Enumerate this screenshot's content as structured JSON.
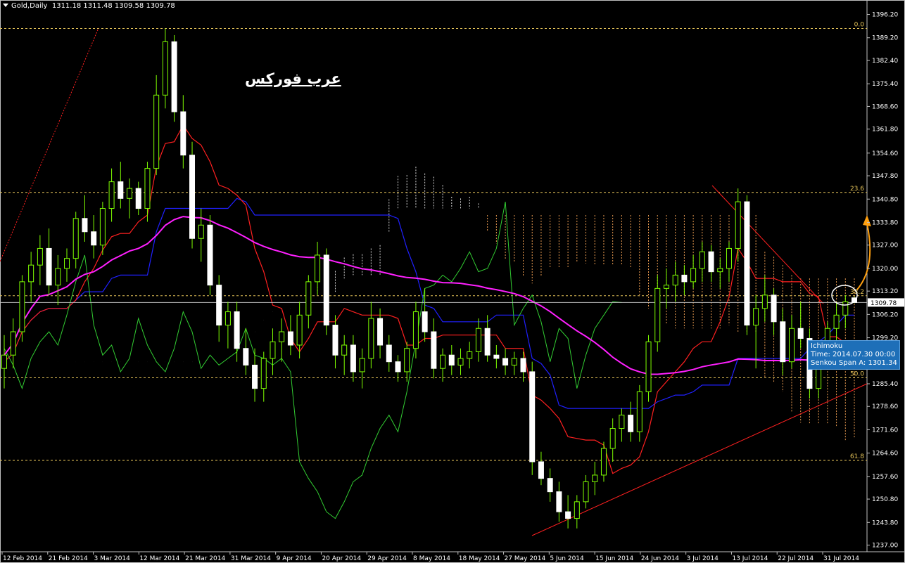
{
  "header": {
    "symbol": "Gold,Daily",
    "ohlc": "1311.18 1311.48 1309.58 1309.78"
  },
  "watermark": "عرب فوركس",
  "current_price_label": "1309.78",
  "tooltip": {
    "name": "Ichimoku",
    "time": "Time: 2014.07.30 00:00",
    "value": "Senkou Span A: 1301.34"
  },
  "colors": {
    "background": "#000000",
    "bull_candle": "#ffffff",
    "bear_candle": "#7fff00",
    "tenkan": "#ff2020",
    "kijun": "#2020ff",
    "chikou": "#32cd32",
    "ma": "#ff20ff",
    "fib": "#e8c65a",
    "trendline": "#ff2020",
    "arrow": "#ffa010",
    "tooltip_bg": "#1e6fb8"
  },
  "chart_data": {
    "type": "candlestick",
    "title": "Gold,Daily",
    "ylim": [
      1235.0,
      1398.0
    ],
    "y_ticks": [
      "1396.20",
      "1389.20",
      "1382.40",
      "1375.40",
      "1368.60",
      "1361.80",
      "1354.60",
      "1347.80",
      "1340.80",
      "1333.80",
      "1327.00",
      "1320.00",
      "1313.20",
      "1306.20",
      "1299.20",
      "1292.20",
      "1285.40",
      "1278.60",
      "1271.60",
      "1264.60",
      "1257.60",
      "1250.80",
      "1243.80",
      "1237.00"
    ],
    "x_ticks": [
      "12 Feb 2014",
      "21 Feb 2014",
      "3 Mar 2014",
      "12 Mar 2014",
      "21 Mar 2014",
      "31 Mar 2014",
      "9 Apr 2014",
      "20 Apr 2014",
      "29 Apr 2014",
      "8 May 2014",
      "18 May 2014",
      "27 May 2014",
      "5 Jun 2014",
      "15 Jun 2014",
      "24 Jun 2014",
      "3 Jul 2014",
      "13 Jul 2014",
      "22 Jul 2014",
      "31 Jul 2014"
    ],
    "fib_levels": [
      {
        "label": "0.0",
        "price": 1392.0
      },
      {
        "label": "23.6",
        "price": 1342.8
      },
      {
        "label": "38.2",
        "price": 1311.8
      },
      {
        "label": "50.0",
        "price": 1287.2
      },
      {
        "label": "61.8",
        "price": 1262.4
      }
    ],
    "last_price": 1309.78,
    "candles": [
      {
        "o": 1290,
        "h": 1300,
        "l": 1284,
        "c": 1294
      },
      {
        "o": 1294,
        "h": 1305,
        "l": 1290,
        "c": 1301
      },
      {
        "o": 1301,
        "h": 1318,
        "l": 1298,
        "c": 1316
      },
      {
        "o": 1316,
        "h": 1325,
        "l": 1310,
        "c": 1321
      },
      {
        "o": 1321,
        "h": 1330,
        "l": 1315,
        "c": 1326
      },
      {
        "o": 1326,
        "h": 1332,
        "l": 1312,
        "c": 1315
      },
      {
        "o": 1315,
        "h": 1324,
        "l": 1309,
        "c": 1320
      },
      {
        "o": 1320,
        "h": 1326,
        "l": 1316,
        "c": 1323
      },
      {
        "o": 1323,
        "h": 1337,
        "l": 1320,
        "c": 1335
      },
      {
        "o": 1335,
        "h": 1342,
        "l": 1328,
        "c": 1331
      },
      {
        "o": 1331,
        "h": 1336,
        "l": 1323,
        "c": 1327
      },
      {
        "o": 1327,
        "h": 1340,
        "l": 1324,
        "c": 1338
      },
      {
        "o": 1338,
        "h": 1350,
        "l": 1334,
        "c": 1346
      },
      {
        "o": 1346,
        "h": 1352,
        "l": 1338,
        "c": 1341
      },
      {
        "o": 1341,
        "h": 1347,
        "l": 1335,
        "c": 1344
      },
      {
        "o": 1344,
        "h": 1346,
        "l": 1336,
        "c": 1338
      },
      {
        "o": 1338,
        "h": 1352,
        "l": 1334,
        "c": 1350
      },
      {
        "o": 1350,
        "h": 1378,
        "l": 1348,
        "c": 1372
      },
      {
        "o": 1372,
        "h": 1392,
        "l": 1368,
        "c": 1388
      },
      {
        "o": 1388,
        "h": 1390,
        "l": 1364,
        "c": 1367
      },
      {
        "o": 1367,
        "h": 1372,
        "l": 1350,
        "c": 1354
      },
      {
        "o": 1354,
        "h": 1358,
        "l": 1326,
        "c": 1329
      },
      {
        "o": 1329,
        "h": 1338,
        "l": 1322,
        "c": 1333
      },
      {
        "o": 1333,
        "h": 1336,
        "l": 1312,
        "c": 1315
      },
      {
        "o": 1315,
        "h": 1318,
        "l": 1298,
        "c": 1303
      },
      {
        "o": 1303,
        "h": 1310,
        "l": 1296,
        "c": 1307
      },
      {
        "o": 1307,
        "h": 1310,
        "l": 1292,
        "c": 1296
      },
      {
        "o": 1296,
        "h": 1302,
        "l": 1288,
        "c": 1291
      },
      {
        "o": 1291,
        "h": 1296,
        "l": 1280,
        "c": 1284
      },
      {
        "o": 1284,
        "h": 1295,
        "l": 1280,
        "c": 1293
      },
      {
        "o": 1293,
        "h": 1302,
        "l": 1288,
        "c": 1298
      },
      {
        "o": 1298,
        "h": 1305,
        "l": 1292,
        "c": 1301
      },
      {
        "o": 1301,
        "h": 1306,
        "l": 1294,
        "c": 1297
      },
      {
        "o": 1297,
        "h": 1310,
        "l": 1293,
        "c": 1306
      },
      {
        "o": 1306,
        "h": 1318,
        "l": 1302,
        "c": 1316
      },
      {
        "o": 1316,
        "h": 1328,
        "l": 1312,
        "c": 1324
      },
      {
        "o": 1324,
        "h": 1326,
        "l": 1300,
        "c": 1303
      },
      {
        "o": 1303,
        "h": 1306,
        "l": 1290,
        "c": 1294
      },
      {
        "o": 1294,
        "h": 1300,
        "l": 1288,
        "c": 1297
      },
      {
        "o": 1297,
        "h": 1300,
        "l": 1286,
        "c": 1289
      },
      {
        "o": 1289,
        "h": 1296,
        "l": 1284,
        "c": 1293
      },
      {
        "o": 1293,
        "h": 1310,
        "l": 1290,
        "c": 1305
      },
      {
        "o": 1305,
        "h": 1308,
        "l": 1293,
        "c": 1297
      },
      {
        "o": 1297,
        "h": 1300,
        "l": 1289,
        "c": 1292
      },
      {
        "o": 1292,
        "h": 1294,
        "l": 1286,
        "c": 1289
      },
      {
        "o": 1289,
        "h": 1298,
        "l": 1286,
        "c": 1296
      },
      {
        "o": 1296,
        "h": 1310,
        "l": 1293,
        "c": 1307
      },
      {
        "o": 1307,
        "h": 1314,
        "l": 1298,
        "c": 1301
      },
      {
        "o": 1301,
        "h": 1305,
        "l": 1287,
        "c": 1290
      },
      {
        "o": 1290,
        "h": 1296,
        "l": 1286,
        "c": 1294
      },
      {
        "o": 1294,
        "h": 1297,
        "l": 1288,
        "c": 1291
      },
      {
        "o": 1291,
        "h": 1296,
        "l": 1288,
        "c": 1293
      },
      {
        "o": 1293,
        "h": 1298,
        "l": 1290,
        "c": 1295
      },
      {
        "o": 1295,
        "h": 1305,
        "l": 1292,
        "c": 1302
      },
      {
        "o": 1302,
        "h": 1306,
        "l": 1292,
        "c": 1294
      },
      {
        "o": 1294,
        "h": 1297,
        "l": 1290,
        "c": 1293
      },
      {
        "o": 1293,
        "h": 1296,
        "l": 1288,
        "c": 1291
      },
      {
        "o": 1291,
        "h": 1295,
        "l": 1288,
        "c": 1293
      },
      {
        "o": 1293,
        "h": 1295,
        "l": 1286,
        "c": 1289
      },
      {
        "o": 1289,
        "h": 1292,
        "l": 1258,
        "c": 1262
      },
      {
        "o": 1262,
        "h": 1265,
        "l": 1255,
        "c": 1257
      },
      {
        "o": 1257,
        "h": 1260,
        "l": 1250,
        "c": 1253
      },
      {
        "o": 1253,
        "h": 1256,
        "l": 1244,
        "c": 1247
      },
      {
        "o": 1247,
        "h": 1252,
        "l": 1242,
        "c": 1245
      },
      {
        "o": 1245,
        "h": 1252,
        "l": 1242,
        "c": 1250
      },
      {
        "o": 1250,
        "h": 1258,
        "l": 1248,
        "c": 1256
      },
      {
        "o": 1256,
        "h": 1262,
        "l": 1252,
        "c": 1258
      },
      {
        "o": 1258,
        "h": 1268,
        "l": 1256,
        "c": 1266
      },
      {
        "o": 1266,
        "h": 1275,
        "l": 1262,
        "c": 1272
      },
      {
        "o": 1272,
        "h": 1278,
        "l": 1268,
        "c": 1276
      },
      {
        "o": 1276,
        "h": 1280,
        "l": 1268,
        "c": 1271
      },
      {
        "o": 1271,
        "h": 1285,
        "l": 1268,
        "c": 1283
      },
      {
        "o": 1283,
        "h": 1300,
        "l": 1280,
        "c": 1298
      },
      {
        "o": 1298,
        "h": 1318,
        "l": 1295,
        "c": 1314
      },
      {
        "o": 1314,
        "h": 1320,
        "l": 1308,
        "c": 1315
      },
      {
        "o": 1315,
        "h": 1322,
        "l": 1310,
        "c": 1318
      },
      {
        "o": 1318,
        "h": 1321,
        "l": 1312,
        "c": 1316
      },
      {
        "o": 1316,
        "h": 1324,
        "l": 1314,
        "c": 1320
      },
      {
        "o": 1320,
        "h": 1328,
        "l": 1316,
        "c": 1325
      },
      {
        "o": 1325,
        "h": 1327,
        "l": 1316,
        "c": 1319
      },
      {
        "o": 1319,
        "h": 1323,
        "l": 1314,
        "c": 1320
      },
      {
        "o": 1320,
        "h": 1328,
        "l": 1316,
        "c": 1326
      },
      {
        "o": 1326,
        "h": 1344,
        "l": 1322,
        "c": 1340
      },
      {
        "o": 1340,
        "h": 1342,
        "l": 1300,
        "c": 1303
      },
      {
        "o": 1303,
        "h": 1312,
        "l": 1290,
        "c": 1308
      },
      {
        "o": 1308,
        "h": 1318,
        "l": 1304,
        "c": 1312
      },
      {
        "o": 1312,
        "h": 1314,
        "l": 1300,
        "c": 1304
      },
      {
        "o": 1304,
        "h": 1308,
        "l": 1288,
        "c": 1292
      },
      {
        "o": 1292,
        "h": 1306,
        "l": 1290,
        "c": 1302
      },
      {
        "o": 1302,
        "h": 1310,
        "l": 1296,
        "c": 1299
      },
      {
        "o": 1299,
        "h": 1302,
        "l": 1281,
        "c": 1284
      },
      {
        "o": 1284,
        "h": 1296,
        "l": 1281,
        "c": 1294
      },
      {
        "o": 1294,
        "h": 1304,
        "l": 1290,
        "c": 1302
      },
      {
        "o": 1302,
        "h": 1310,
        "l": 1298,
        "c": 1306
      },
      {
        "o": 1306,
        "h": 1312,
        "l": 1302,
        "c": 1310
      },
      {
        "o": 1311.18,
        "h": 1311.48,
        "l": 1309.58,
        "c": 1309.78
      }
    ]
  }
}
